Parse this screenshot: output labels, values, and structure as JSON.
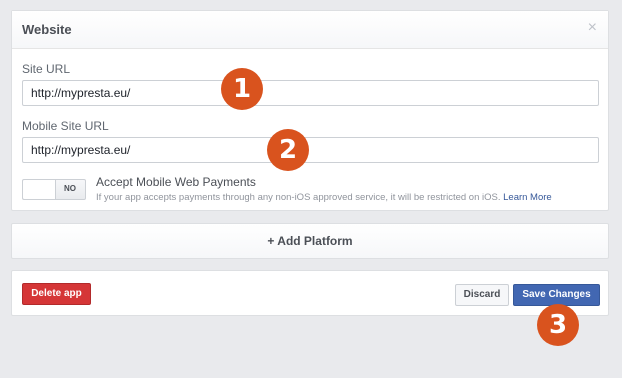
{
  "website_panel": {
    "title": "Website",
    "close_glyph": "×",
    "site_url_label": "Site URL",
    "site_url_value": "http://mypresta.eu/",
    "mobile_url_label": "Mobile Site URL",
    "mobile_url_value": "http://mypresta.eu/",
    "toggle_state": "NO",
    "payments_title": "Accept Mobile Web Payments",
    "payments_desc": "If your app accepts payments through any non-iOS approved service, it will be restricted on iOS.",
    "learn_more": "Learn More"
  },
  "add_platform": {
    "label": "+ Add Platform"
  },
  "footer": {
    "delete_label": "Delete app",
    "discard_label": "Discard",
    "save_label": "Save Changes"
  },
  "annotations": {
    "marker_1": "1",
    "marker_2": "2",
    "marker_3": "3"
  },
  "colors": {
    "delete": "#d53637",
    "save": "#4267b2",
    "marker": "#d9531e",
    "link": "#365899"
  }
}
